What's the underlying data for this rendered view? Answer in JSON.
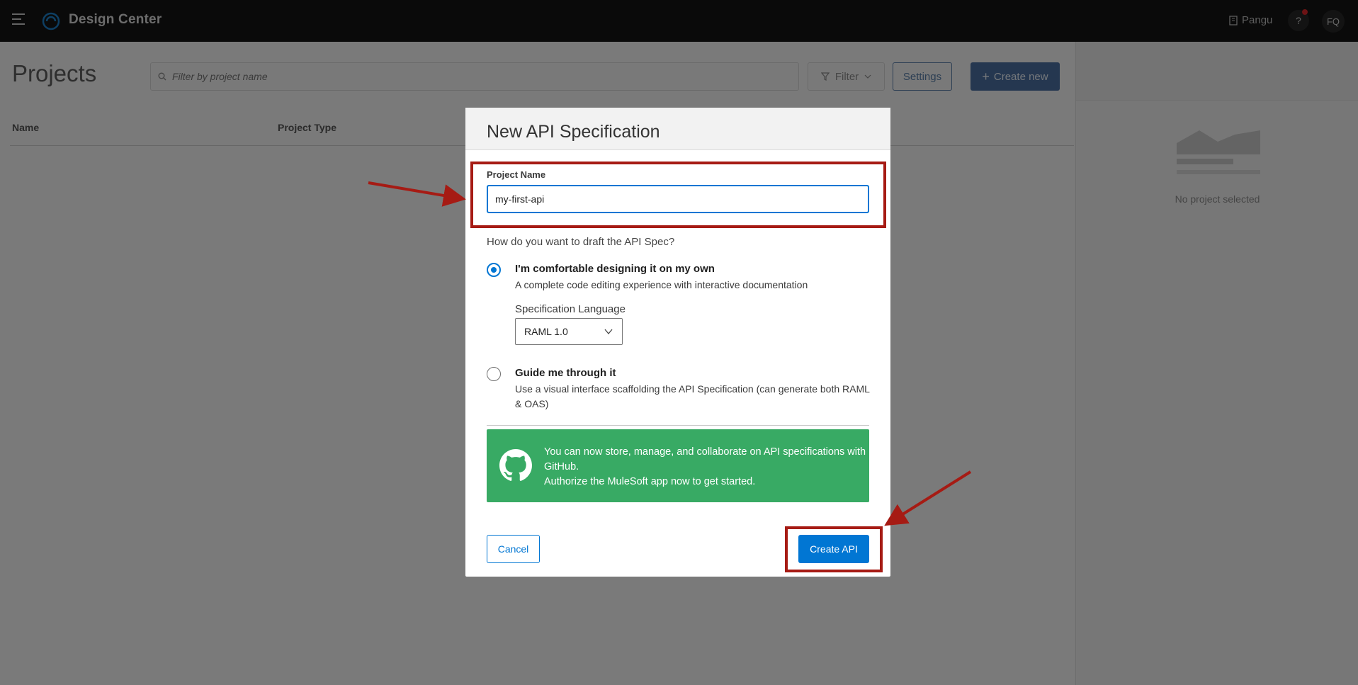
{
  "topbar": {
    "app_title": "Design Center",
    "org_name": "Pangu",
    "help_label": "?",
    "avatar_initials": "FQ"
  },
  "page": {
    "title": "Projects",
    "filter_placeholder": "Filter by project name",
    "filter_button": "Filter",
    "settings_button": "Settings",
    "create_new_button": "Create new",
    "columns": [
      "Name",
      "Project Type"
    ]
  },
  "right_panel": {
    "empty_text": "No project selected"
  },
  "modal": {
    "title": "New API Specification",
    "project_name_label": "Project Name",
    "project_name_value": "my-first-api",
    "question": "How do you want to draft the API Spec?",
    "options": [
      {
        "title": "I'm comfortable designing it on my own",
        "description": "A complete code editing experience with interactive documentation",
        "selected": true
      },
      {
        "title": "Guide me through it",
        "description": "Use a visual interface scaffolding the API Specification (can generate both RAML & OAS)",
        "selected": false
      }
    ],
    "spec_language_label": "Specification Language",
    "spec_language_value": "RAML 1.0",
    "github_banner": {
      "line1": "You can now store, manage, and collaborate on API specifications with GitHub.",
      "line2": "Authorize the MuleSoft app now to get started."
    },
    "cancel_button": "Cancel",
    "create_button": "Create API"
  },
  "colors": {
    "primary": "#0176d3",
    "github_green": "#38aa64",
    "annotation_red": "#a61b14",
    "topbar": "#141414"
  }
}
